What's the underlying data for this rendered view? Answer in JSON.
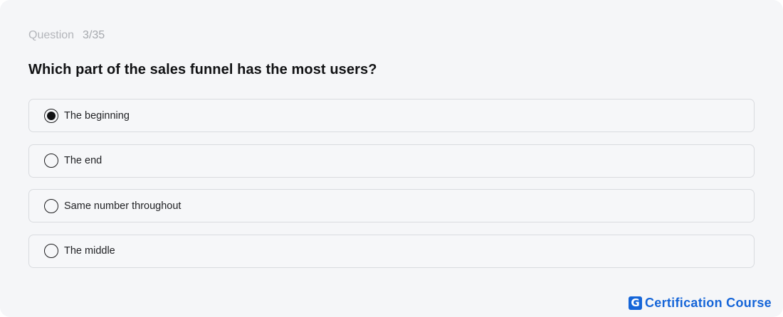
{
  "question": {
    "label": "Question",
    "number": "3/35",
    "text": "Which part of the sales funnel has the most users?"
  },
  "options": [
    {
      "label": "The beginning",
      "selected": true
    },
    {
      "label": "The end",
      "selected": false
    },
    {
      "label": "Same number throughout",
      "selected": false
    },
    {
      "label": "The middle",
      "selected": false
    }
  ],
  "brand": {
    "logo_letter": "G",
    "text": "Certification Course",
    "color": "#1565d8"
  }
}
